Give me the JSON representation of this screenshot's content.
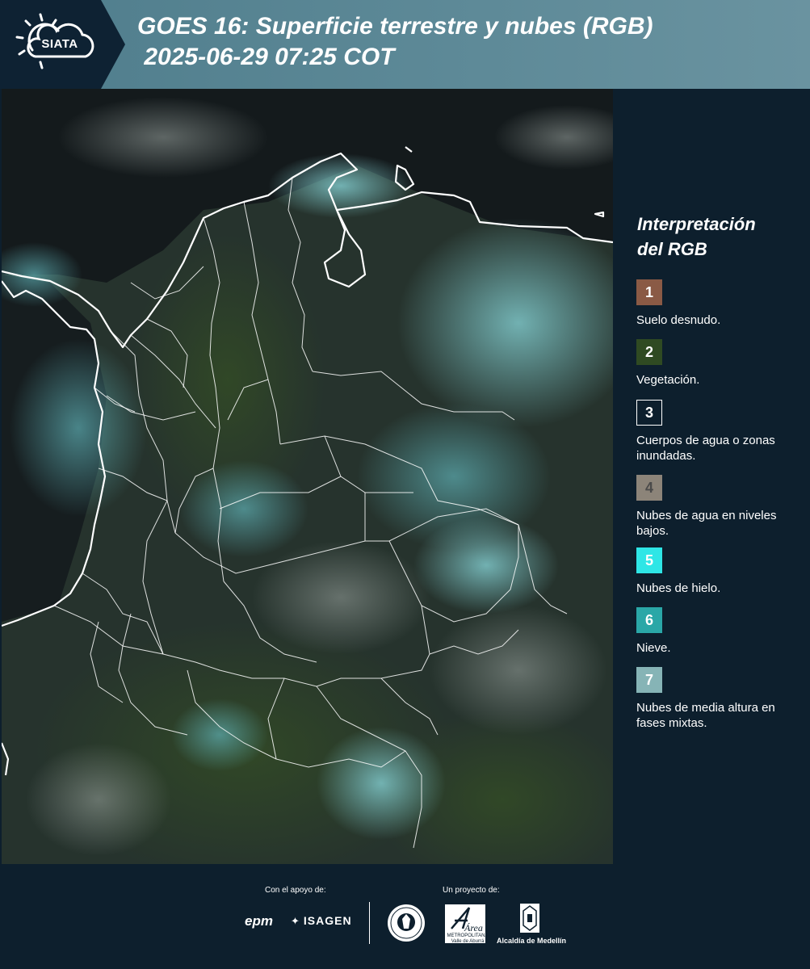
{
  "header": {
    "logo_text": "SIATA",
    "title_line1": "GOES 16: Superficie terrestre y nubes (RGB)",
    "title_line2": " 2025-06-29 07:25 COT"
  },
  "map": {
    "border_color": "#ffffff"
  },
  "legend": {
    "title_line1": "Interpretación",
    "title_line2": "del RGB",
    "items": [
      {
        "number": "1",
        "label": "Suelo desnudo.",
        "color": "#8a5a45"
      },
      {
        "number": "2",
        "label": "Vegetación.",
        "color": "#2f4a22"
      },
      {
        "number": "3",
        "label": "Cuerpos de agua o zonas inundadas.",
        "color": "#0d1f2d"
      },
      {
        "number": "4",
        "label": "Nubes de agua en niveles bajos.",
        "color": "#8c8479"
      },
      {
        "number": "5",
        "label": "Nubes de hielo.",
        "color": "#2ee6e6"
      },
      {
        "number": "6",
        "label": "Nieve.",
        "color": "#2aa7a7"
      },
      {
        "number": "7",
        "label": "Nubes de media altura en fases mixtas.",
        "color": "#86b4b6"
      }
    ]
  },
  "footer": {
    "support_label": "Con el apoyo de:",
    "project_label": "Un proyecto de:",
    "epm": "epm",
    "isagen": "ISAGEN",
    "amva_line1": "METROPOLITANA",
    "amva_line2": "Valle de Aburrá",
    "amva_logo_text": "Área",
    "alcaldia": "Alcaldía de Medellín"
  }
}
